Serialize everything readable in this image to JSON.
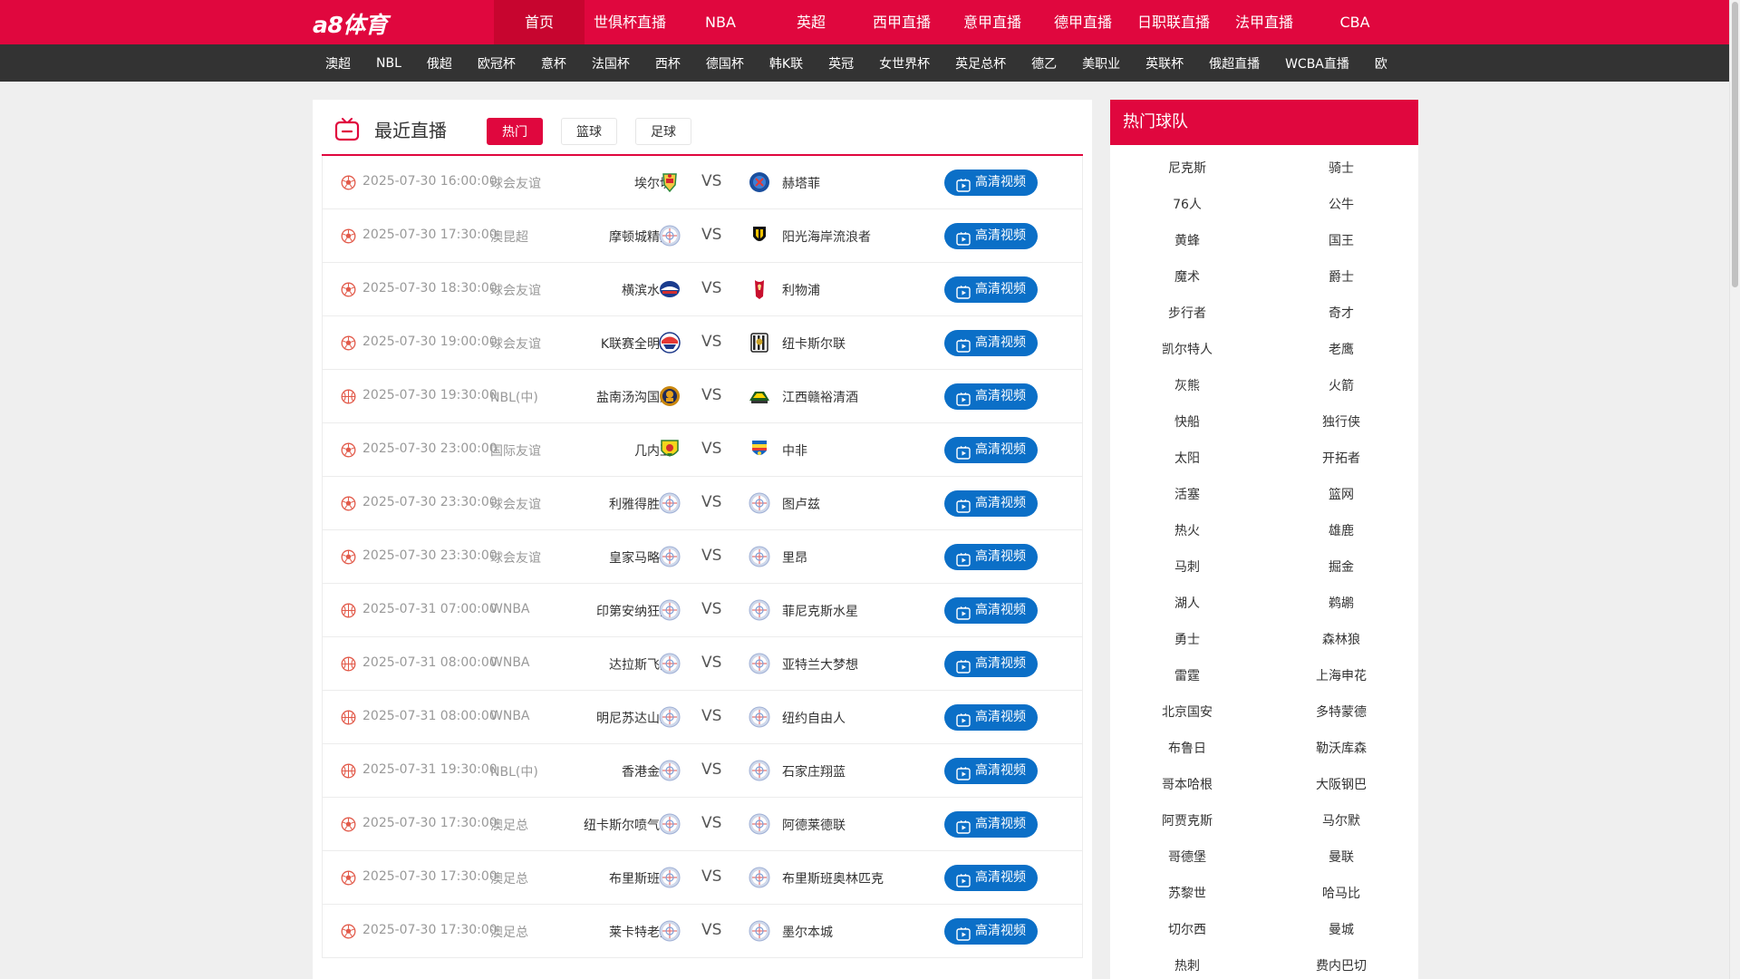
{
  "brand": {
    "logo": "a8体育",
    "accent": "#e0073e",
    "button_blue": "#0b6fc7"
  },
  "main_nav": [
    "首页",
    "世俱杯直播",
    "NBA",
    "英超",
    "西甲直播",
    "意甲直播",
    "德甲直播",
    "日职联直播",
    "法甲直播",
    "CBA"
  ],
  "sub_nav": [
    "澳超",
    "NBL",
    "俄超",
    "欧冠杯",
    "意杯",
    "法国杯",
    "西杯",
    "德国杯",
    "韩K联",
    "英冠",
    "女世界杯",
    "英足总杯",
    "德乙",
    "美职业",
    "英联杯",
    "俄超直播",
    "WCBA直播",
    "欧"
  ],
  "live": {
    "title": "最近直播",
    "tabs": [
      "热门",
      "篮球",
      "足球"
    ],
    "button_label": "高清视频",
    "vs": "VS",
    "matches": [
      {
        "sport": "football",
        "time": "2025-07-30 16:00:00",
        "league": "球会友谊",
        "home": "埃尔切",
        "away": "赫塔菲",
        "home_logo": "elche",
        "away_logo": "getafe"
      },
      {
        "sport": "football",
        "time": "2025-07-30 17:30:00",
        "league": "澳昆超",
        "home": "摩顿城精英",
        "away": "阳光海岸流浪者",
        "home_logo": "generic",
        "away_logo": "sunshine"
      },
      {
        "sport": "football",
        "time": "2025-07-30 18:30:00",
        "league": "球会友谊",
        "home": "横滨水手",
        "away": "利物浦",
        "home_logo": "yokohama",
        "away_logo": "liverpool"
      },
      {
        "sport": "football",
        "time": "2025-07-30 19:00:00",
        "league": "球会友谊",
        "home": "K联赛全明星",
        "away": "纽卡斯尔联",
        "home_logo": "kleague",
        "away_logo": "newcastle"
      },
      {
        "sport": "basketball",
        "time": "2025-07-30 19:30:00",
        "league": "NBL(中)",
        "home": "盐南汤沟国藏",
        "away": "江西赣裕清酒",
        "home_logo": "yannan",
        "away_logo": "jiangxi"
      },
      {
        "sport": "football",
        "time": "2025-07-30 23:00:00",
        "league": "国际友谊",
        "home": "几内亚",
        "away": "中非",
        "home_logo": "guinea",
        "away_logo": "car"
      },
      {
        "sport": "football",
        "time": "2025-07-30 23:30:00",
        "league": "球会友谊",
        "home": "利雅得胜利",
        "away": "图卢兹",
        "home_logo": "generic",
        "away_logo": "generic"
      },
      {
        "sport": "football",
        "time": "2025-07-30 23:30:00",
        "league": "球会友谊",
        "home": "皇家马略卡",
        "away": "里昂",
        "home_logo": "generic",
        "away_logo": "generic"
      },
      {
        "sport": "basketball",
        "time": "2025-07-31 07:00:00",
        "league": "WNBA",
        "home": "印第安纳狂热",
        "away": "菲尼克斯水星",
        "home_logo": "generic",
        "away_logo": "generic"
      },
      {
        "sport": "basketball",
        "time": "2025-07-31 08:00:00",
        "league": "WNBA",
        "home": "达拉斯飞翼",
        "away": "亚特兰大梦想",
        "home_logo": "generic",
        "away_logo": "generic"
      },
      {
        "sport": "basketball",
        "time": "2025-07-31 08:00:00",
        "league": "WNBA",
        "home": "明尼苏达山猫",
        "away": "纽约自由人",
        "home_logo": "generic",
        "away_logo": "generic"
      },
      {
        "sport": "basketball",
        "time": "2025-07-31 19:30:00",
        "league": "NBL(中)",
        "home": "香港金牛",
        "away": "石家庄翔蓝",
        "home_logo": "generic",
        "away_logo": "generic"
      },
      {
        "sport": "football",
        "time": "2025-07-30 17:30:00",
        "league": "澳足总",
        "home": "纽卡斯尔喷气机",
        "away": "阿德莱德联",
        "home_logo": "generic",
        "away_logo": "generic"
      },
      {
        "sport": "football",
        "time": "2025-07-30 17:30:00",
        "league": "澳足总",
        "home": "布里斯班城",
        "away": "布里斯班奥林匹克",
        "home_logo": "generic",
        "away_logo": "generic"
      },
      {
        "sport": "football",
        "time": "2025-07-30 17:30:00",
        "league": "澳足总",
        "home": "莱卡特老虎",
        "away": "墨尔本城",
        "home_logo": "generic",
        "away_logo": "generic"
      }
    ]
  },
  "hot_teams": {
    "title": "热门球队",
    "teams": [
      "尼克斯",
      "骑士",
      "76人",
      "公牛",
      "黄蜂",
      "国王",
      "魔术",
      "爵士",
      "步行者",
      "奇才",
      "凯尔特人",
      "老鹰",
      "灰熊",
      "火箭",
      "快船",
      "独行侠",
      "太阳",
      "开拓者",
      "活塞",
      "篮网",
      "热火",
      "雄鹿",
      "马刺",
      "掘金",
      "湖人",
      "鹈鹕",
      "勇士",
      "森林狼",
      "雷霆",
      "上海申花",
      "北京国安",
      "多特蒙德",
      "布鲁日",
      "勒沃库森",
      "哥本哈根",
      "大阪钢巴",
      "阿贾克斯",
      "马尔默",
      "哥德堡",
      "曼联",
      "苏黎世",
      "哈马比",
      "切尔西",
      "曼城",
      "热刺",
      "费内巴切"
    ]
  }
}
